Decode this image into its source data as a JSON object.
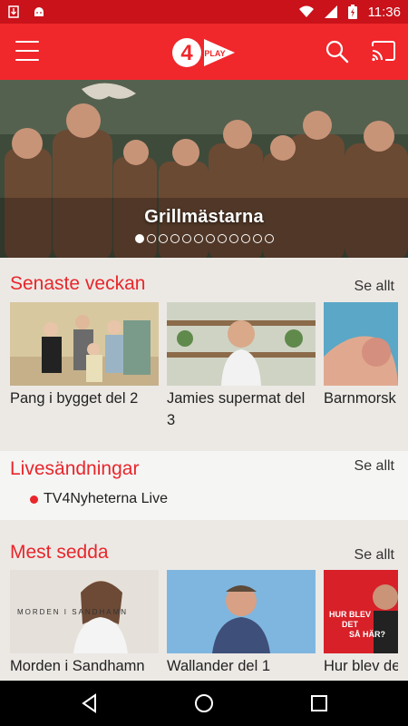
{
  "status_bar": {
    "time": "11:36"
  },
  "hero": {
    "title": "Grillmästarna",
    "page_count": 12,
    "active_page": 1
  },
  "sections": {
    "recent": {
      "title": "Senaste veckan",
      "see_all": "Se allt",
      "items": [
        {
          "title": "Pang i bygget del 2"
        },
        {
          "title": "Jamies supermat del 3"
        },
        {
          "title": "Barnmorsk"
        }
      ]
    },
    "live": {
      "title": "Livesändningar",
      "see_all": "Se allt",
      "item": "TV4Nyheterna Live"
    },
    "popular": {
      "title": "Mest sedda",
      "see_all": "Se allt",
      "items": [
        {
          "title": "Morden i Sandhamn",
          "overlay": "MORDEN I SANDHAMN"
        },
        {
          "title": "Wallander del 1"
        },
        {
          "title": "Hur blev de",
          "overlay1": "HUR BLEV",
          "overlay2": "DET",
          "overlay3": "SÅ HÄR?"
        }
      ]
    }
  },
  "colors": {
    "accent": "#f0272b",
    "status": "#c9121a",
    "header_text": "#e8262b"
  },
  "icons": [
    "menu-icon",
    "tv4-play-logo",
    "search-icon",
    "cast-icon",
    "back-icon",
    "home-icon",
    "recents-icon"
  ]
}
